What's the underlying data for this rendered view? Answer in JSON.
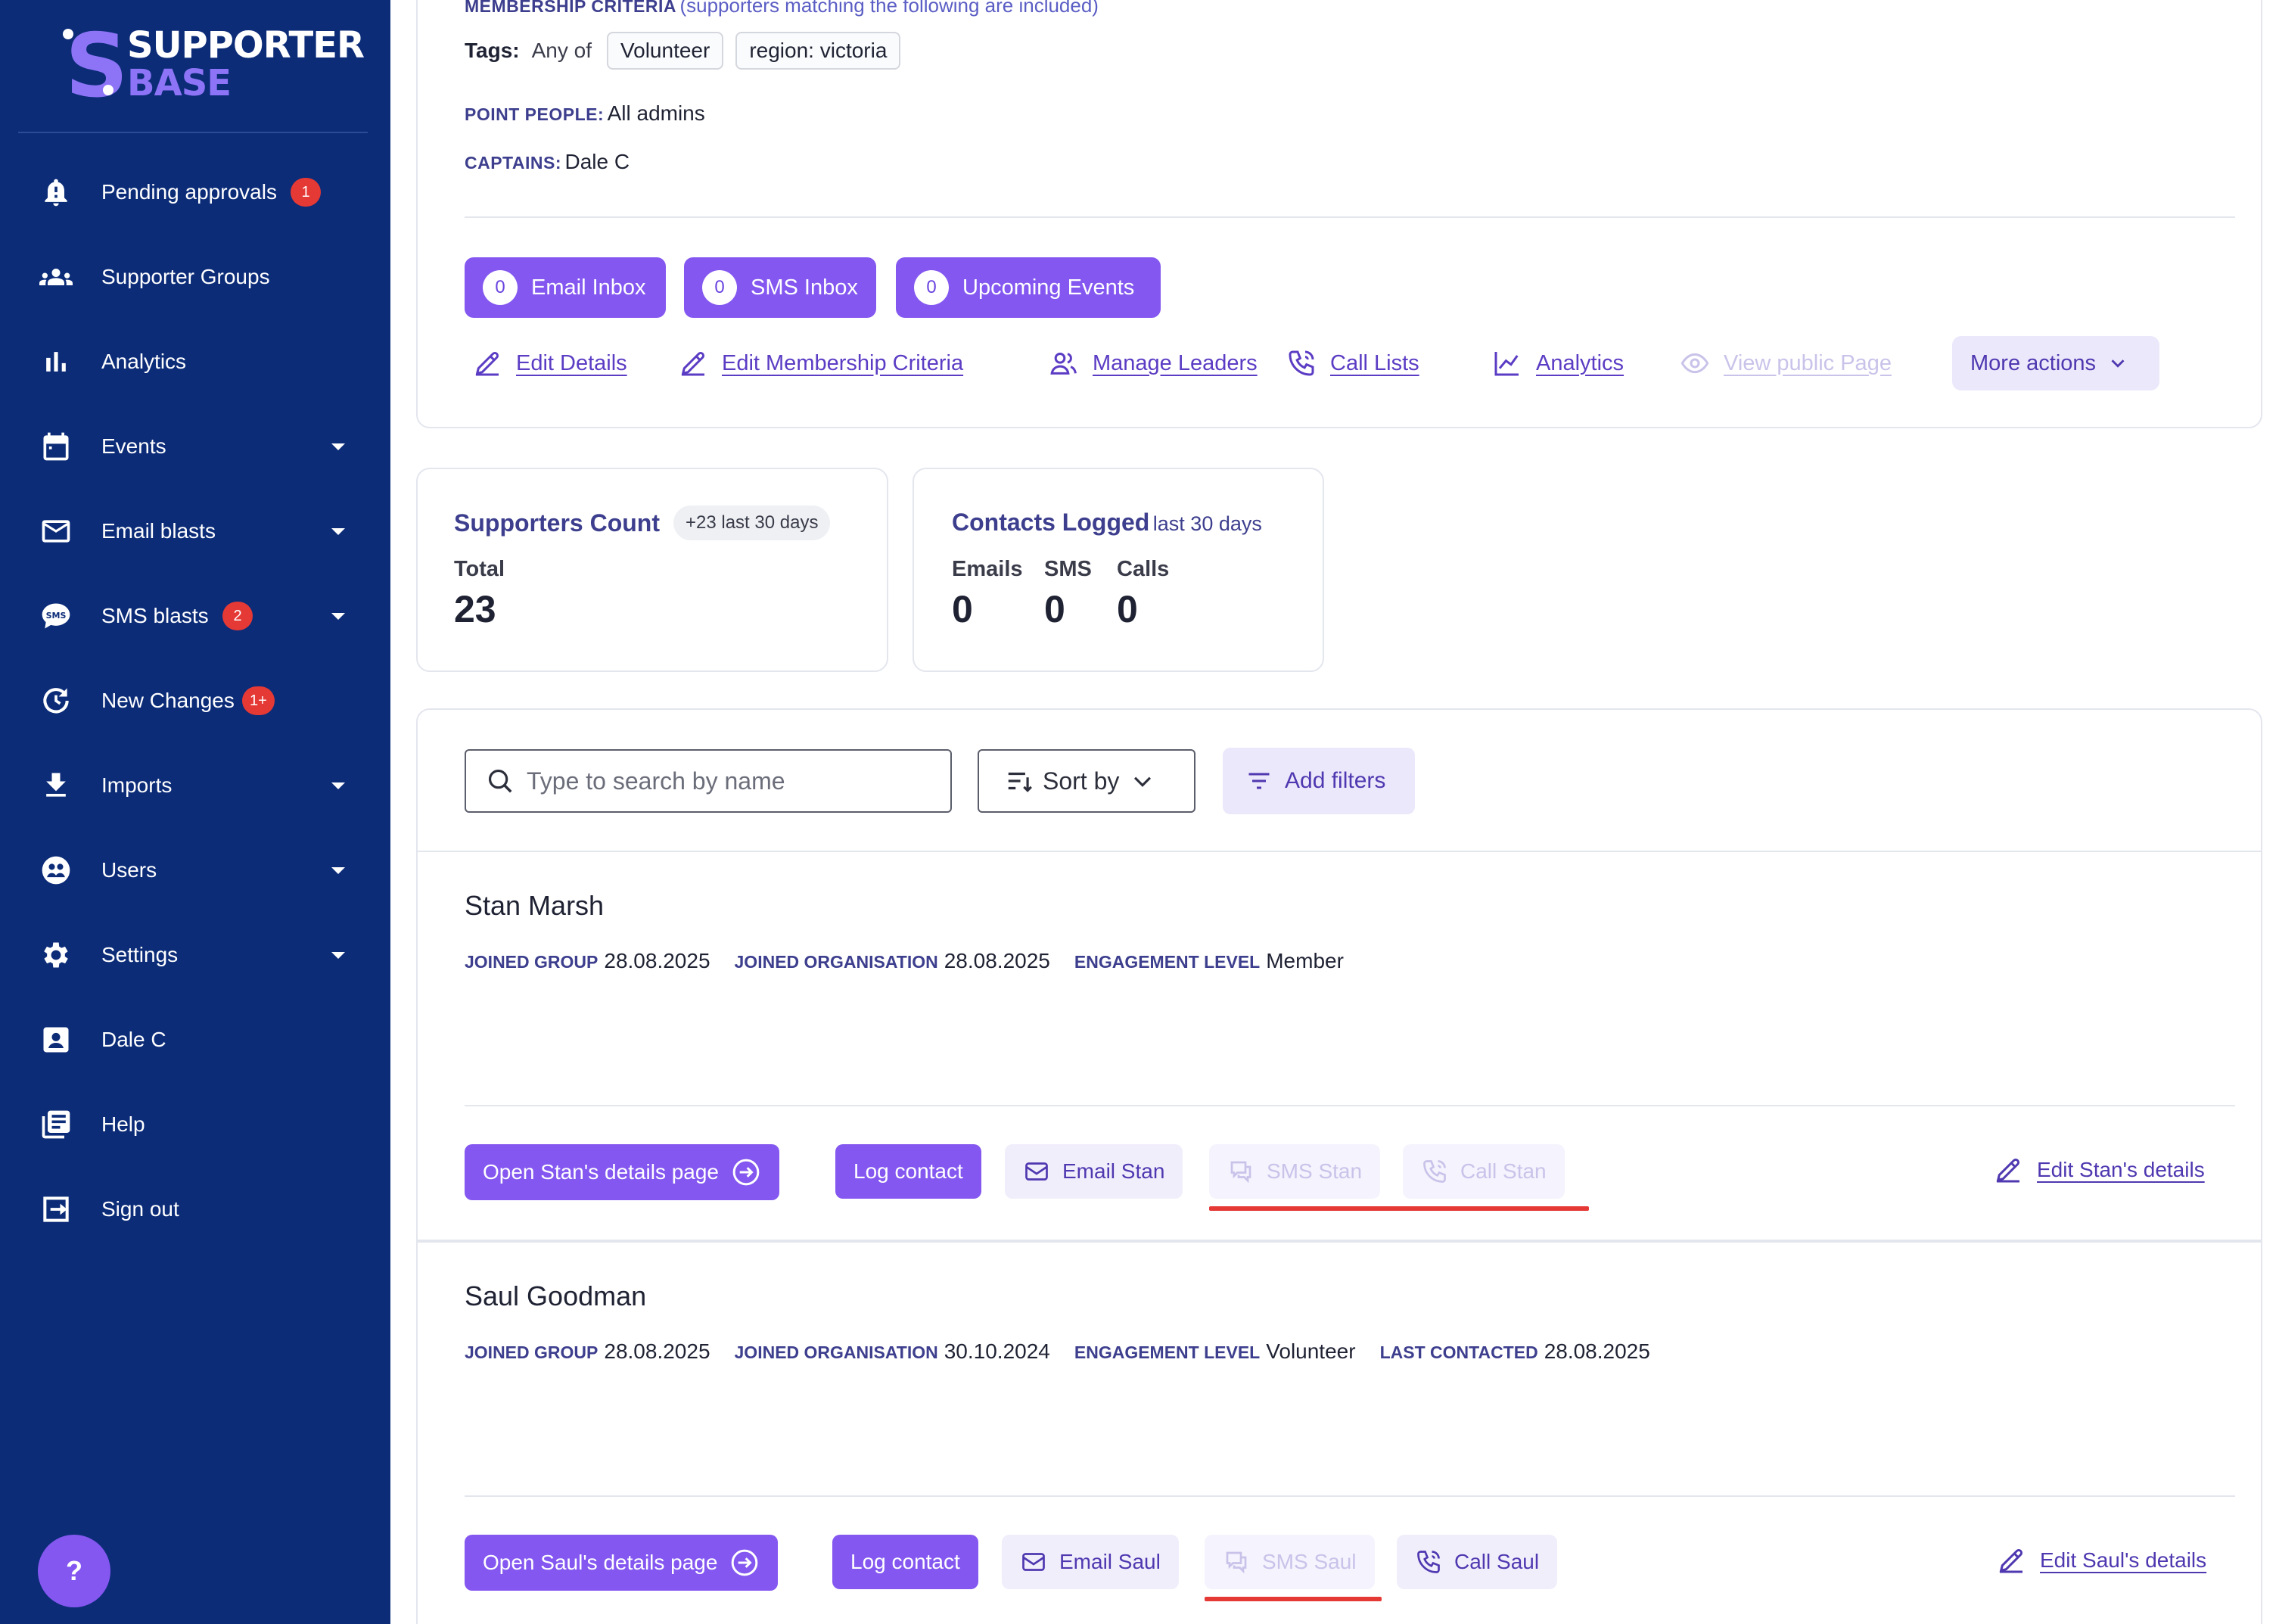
{
  "brand": {
    "line1": "SUPPORTER",
    "line2": "BASE",
    "accent": "#8457f0",
    "sidebar_bg": "#0c2c78"
  },
  "sidebar": {
    "items": [
      {
        "label": "Pending approvals",
        "icon": "bell-icon",
        "badge": "1"
      },
      {
        "label": "Supporter Groups",
        "icon": "people-icon"
      },
      {
        "label": "Analytics",
        "icon": "bar-chart-icon"
      },
      {
        "label": "Events",
        "icon": "calendar-icon",
        "has_caret": true
      },
      {
        "label": "Email blasts",
        "icon": "mail-icon",
        "has_caret": true
      },
      {
        "label": "SMS blasts",
        "icon": "sms-icon",
        "badge": "2",
        "has_caret": true
      },
      {
        "label": "New Changes",
        "icon": "refresh-icon",
        "badge": "1+"
      },
      {
        "label": "Imports",
        "icon": "download-icon",
        "has_caret": true
      },
      {
        "label": "Users",
        "icon": "users-icon",
        "has_caret": true
      },
      {
        "label": "Settings",
        "icon": "gear-icon",
        "has_caret": true
      },
      {
        "label": "Dale C",
        "icon": "contact-icon"
      },
      {
        "label": "Help",
        "icon": "book-icon"
      },
      {
        "label": "Sign out",
        "icon": "sign-out-icon"
      }
    ],
    "help_button": "?"
  },
  "group": {
    "membership_label": "MEMBERSHIP CRITERIA",
    "membership_note": "(supporters matching the following are included)",
    "tags_label": "Tags:",
    "tags_mode": "Any of",
    "tags": [
      "Volunteer",
      "region: victoria"
    ],
    "point_people_label": "POINT PEOPLE:",
    "point_people_value": "All admins",
    "captains_label": "CAPTAINS:",
    "captains_value": "Dale C",
    "inbox_buttons": [
      {
        "count": "0",
        "label": "Email Inbox"
      },
      {
        "count": "0",
        "label": "SMS Inbox"
      },
      {
        "count": "0",
        "label": "Upcoming Events"
      }
    ],
    "actions": {
      "edit_details": "Edit Details",
      "edit_membership": "Edit Membership Criteria",
      "manage_leaders": "Manage Leaders",
      "call_lists": "Call Lists",
      "analytics": "Analytics",
      "view_public": "View public Page",
      "more_actions": "More actions"
    }
  },
  "stats": {
    "supporters": {
      "title": "Supporters Count",
      "badge": "+23 last 30 days",
      "total_label": "Total",
      "total_value": "23"
    },
    "contacts": {
      "title": "Contacts Logged",
      "subtitle": "last 30 days",
      "emails_label": "Emails",
      "emails_value": "0",
      "sms_label": "SMS",
      "sms_value": "0",
      "calls_label": "Calls",
      "calls_value": "0"
    }
  },
  "list": {
    "search_placeholder": "Type to search by name",
    "sort_label": "Sort by",
    "filter_label": "Add filters"
  },
  "people": [
    {
      "name": "Stan Marsh",
      "joined_group_label": "JOINED GROUP",
      "joined_group": "28.08.2025",
      "joined_org_label": "JOINED ORGANISATION",
      "joined_org": "28.08.2025",
      "engagement_label": "ENGAGEMENT LEVEL",
      "engagement": "Member",
      "open_details": "Open Stan's details page",
      "log_contact": "Log contact",
      "email": "Email Stan",
      "sms": "SMS Stan",
      "call": "Call Stan",
      "edit": "Edit Stan's details"
    },
    {
      "name": "Saul Goodman",
      "joined_group_label": "JOINED GROUP",
      "joined_group": "28.08.2025",
      "joined_org_label": "JOINED ORGANISATION",
      "joined_org": "30.10.2024",
      "engagement_label": "ENGAGEMENT LEVEL",
      "engagement": "Volunteer",
      "last_contacted_label": "LAST CONTACTED",
      "last_contacted": "28.08.2025",
      "open_details": "Open Saul's details page",
      "log_contact": "Log contact",
      "email": "Email Saul",
      "sms": "SMS Saul",
      "call": "Call Saul",
      "edit": "Edit Saul's details"
    }
  ]
}
